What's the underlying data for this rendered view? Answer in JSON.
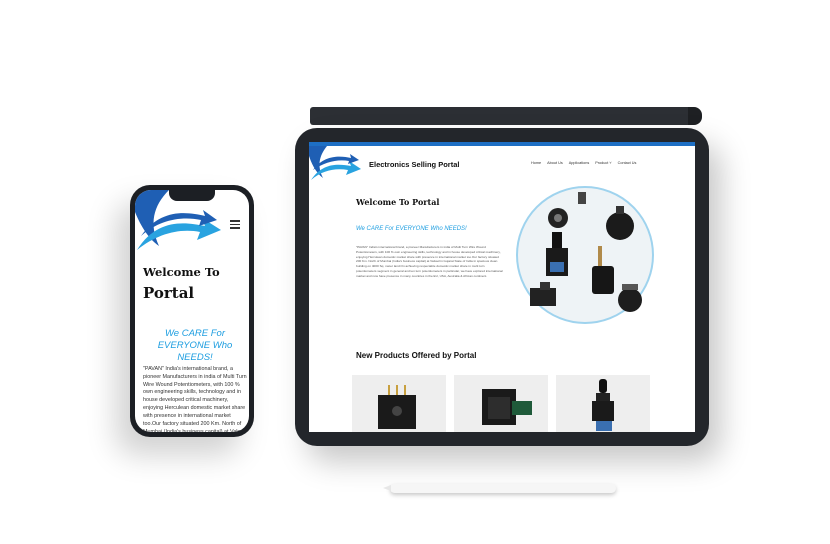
{
  "mobile": {
    "welcome_line1": "Welcome To",
    "welcome_line2": "Portal",
    "tagline": "We CARE For EVERYONE Who NEEDS!",
    "body": "\"PAVAN\" India's international brand, a pioneer Manufacturers in india of Multi Turn Wire Wound Potentiometers, with 100 % own engineering skills, technology and in house developed critical machinery, enjoying Herculean domestic market share with presence in international market too.Our factory situated 200 Km. North of Mumbai (India's business capital) at Valsad"
  },
  "tablet": {
    "brand": "Electronics Selling Portal",
    "nav": [
      "Home",
      "About Us",
      "Applications",
      "Product",
      "Contact Us"
    ],
    "welcome": "Welcome To  Portal",
    "tagline": "We CARE For EVERYONE Who NEEDS!",
    "body": "\"PAVAN\" India's international brand, a pioneer Manufacturers in india of Multi Turn Wire Wound Potentiometers, with 100 % own engineering skills, technology and in house developed critical machinery, enjoying Herculean domestic market share with presence in international market too.Our factory situated 200 Km. North of Mumbai (India's business capital) at Valsad in Gujarat State of India in spacious clean building on 4000 Sq. meter land.On achieving respectable domestic market share in multi turn potentiometers segment in general and ten turn potentiometers in particular, we have explored international market and now have presence in many countries in the EU, USA, Australia & African continent.",
    "new_products_title": "New Products Offered by  Portal"
  },
  "colors": {
    "accent_blue": "#1e9ee0",
    "brand_blue": "#1e6fc4",
    "device_dark": "#23262b"
  }
}
